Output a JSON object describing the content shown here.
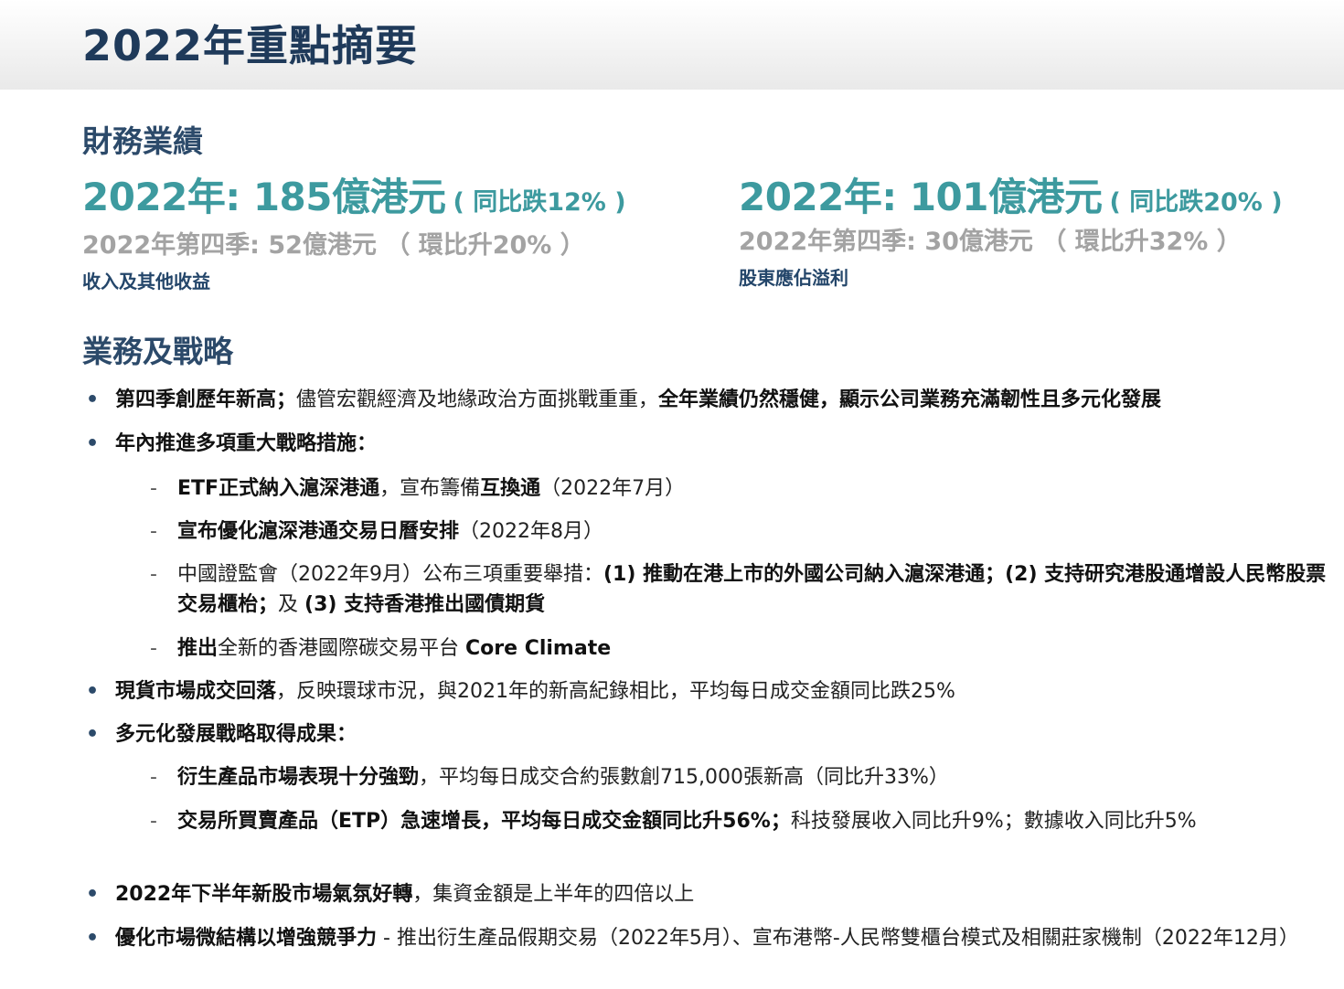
{
  "page": {
    "title": "2022年重點摘要"
  },
  "financial": {
    "section_title": "財務業績",
    "revenue": {
      "main": "2022年: 185億港元",
      "change": "( 同比跌12% )",
      "q4": "2022年第四季: 52億港元 （ 環比升20% ）",
      "label": "收入及其他收益"
    },
    "profit": {
      "main": "2022年: 101億港元",
      "change": "( 同比跌20% )",
      "q4": "2022年第四季: 30億港元 （ 環比升32% ）",
      "label": "股東應佔溢利"
    }
  },
  "business": {
    "section_title": "業務及戰略",
    "b1": {
      "bold1": "第四季創歷年新高；",
      "text1": "儘管宏觀經濟及地緣政治方面挑戰重重，",
      "bold2": "全年業績仍然穩健，顯示公司業務充滿韌性且多元化發展"
    },
    "b2": {
      "bold": "年內推進多項重大戰略措施："
    },
    "b2a": {
      "bold1": "ETF正式納入滬深港通",
      "text1": "，宣布籌備",
      "bold2": "互換通",
      "text2": "（2022年7月）"
    },
    "b2b": {
      "bold": "宣布優化滬深港通交易日曆安排",
      "text": "（2022年8月）"
    },
    "b2c": {
      "text1": "中國證監會（2022年9月）公布三項重要舉措：",
      "bold1": "(1) 推動在港上市的外國公司納入滬深港通；(2) 支持研究港股通增設人民幣股票交易櫃枱；",
      "text2": "及 ",
      "bold2": "(3) 支持香港推出國債期貨"
    },
    "b2d": {
      "bold1": "推出",
      "text1": "全新的香港國際碳交易平台 ",
      "bold2": "Core Climate"
    },
    "b3": {
      "bold": "現貨市場成交回落",
      "text": "，反映環球市況，與2021年的新高紀錄相比，平均每日成交金額同比跌25%"
    },
    "b4": {
      "bold": "多元化發展戰略取得成果："
    },
    "b4a": {
      "bold": "衍生產品市場表現十分強勁",
      "text": "，平均每日成交合約張數創715,000張新高（同比升33%）"
    },
    "b4b": {
      "bold": "交易所買賣產品（ETP）急速增長，平均每日成交金額同比升56%；",
      "text": "科技發展收入同比升9%；數據收入同比升5%"
    },
    "b5": {
      "bold": "2022年下半年新股市場氣氛好轉",
      "text": "，集資金額是上半年的四倍以上"
    },
    "b6": {
      "bold": "優化市場微結構以增強競爭力",
      "text": " - 推出衍生產品假期交易（2022年5月）、宣布港幣-人民幣雙櫃台模式及相關莊家機制（2022年12月）"
    }
  },
  "markers": {
    "bullet": "•",
    "dash": "-"
  }
}
